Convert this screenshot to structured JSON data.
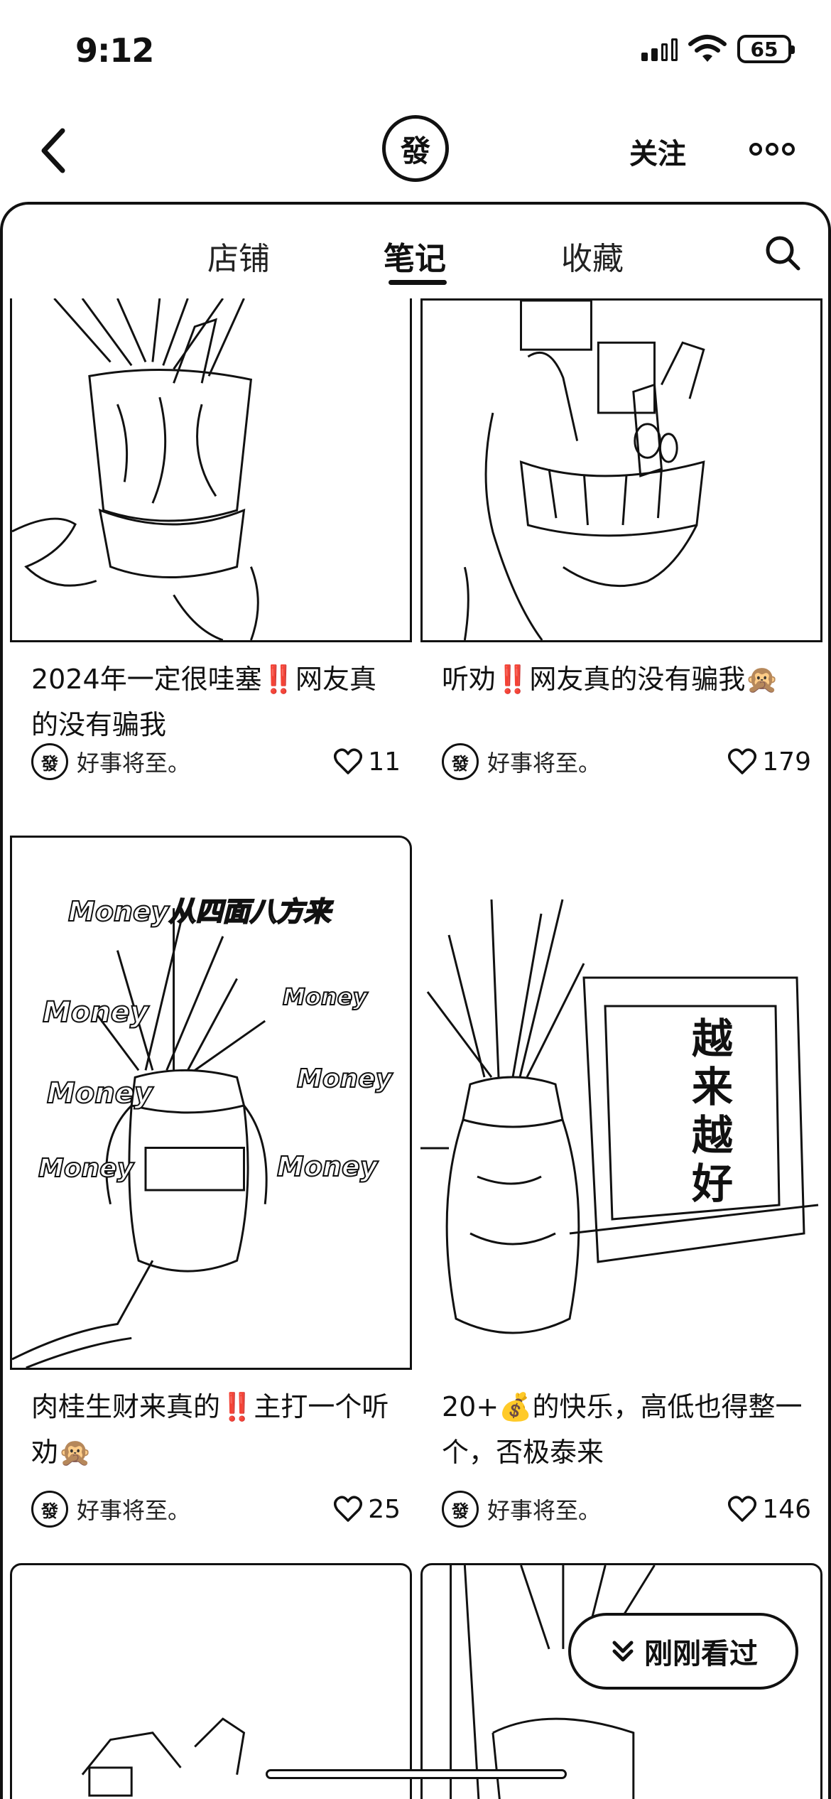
{
  "status_bar": {
    "time": "9:12",
    "battery": "65"
  },
  "header": {
    "avatar_text": "發",
    "follow_label": "关注"
  },
  "tabs": [
    {
      "label": "店铺",
      "active": false
    },
    {
      "label": "笔记",
      "active": true
    },
    {
      "label": "收藏",
      "active": false
    }
  ],
  "notes": [
    {
      "title": "2024年一定很哇塞‼️网友真的没有骗我",
      "author": "好事将至。",
      "likes": "11"
    },
    {
      "title": "听劝‼️网友真的没有骗我🙊",
      "author": "好事将至。",
      "likes": "179"
    },
    {
      "title": "肉桂生财来真的‼️主打一个听劝🙊",
      "author": "好事将至。",
      "likes": "25",
      "overlay_title": "Money从四面八方来",
      "overlay_words": [
        "Money",
        "Money",
        "Money",
        "Money",
        "Money",
        "Money"
      ]
    },
    {
      "title": "20+💰的快乐，高低也得整一个，否极泰来",
      "author": "好事将至。",
      "likes": "146",
      "frame_text": "越来越好"
    }
  ],
  "recently_viewed_label": "刚刚看过"
}
